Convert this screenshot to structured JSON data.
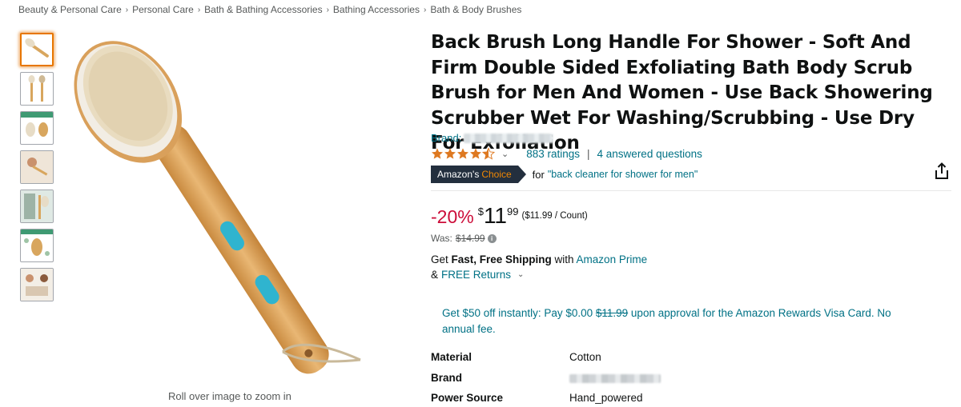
{
  "breadcrumb": {
    "items": [
      "Beauty & Personal Care",
      "Personal Care",
      "Bath & Bathing Accessories",
      "Bathing Accessories",
      "Bath & Body Brushes"
    ],
    "separator": "›"
  },
  "gallery": {
    "thumbnail_count": 7,
    "selected_index": 0,
    "zoom_hint": "Roll over image to zoom in"
  },
  "product": {
    "title": "Back Brush Long Handle For Shower - Soft And Firm Double Sided Exfoliating Bath Body Scrub Brush for Men And Women - Use Back Showering Scrubber Wet For Washing/Scrubbing - Use Dry For Exfoliation",
    "brand_label": "Brand:",
    "rating_stars": 4.5,
    "ratings_text": "883 ratings",
    "answered_text": "4 answered questions",
    "choice_badge_prefix": "Amazon's",
    "choice_badge_word": "Choice",
    "choice_for": "for",
    "choice_query": "\"back cleaner for shower for men\""
  },
  "price": {
    "discount": "-20%",
    "currency_symbol": "$",
    "whole": "11",
    "fraction": "99",
    "per_unit": "($11.99 / Count)",
    "was_label": "Was:",
    "was_price": "$14.99",
    "info_icon_text": "i"
  },
  "shipping": {
    "get": "Get ",
    "fast_free": "Fast, Free Shipping",
    "with": " with ",
    "prime_link": "Amazon Prime",
    "returns_prefix": "& ",
    "returns_link": "FREE Returns"
  },
  "promo": {
    "text_before": "Get $50 off instantly: Pay $0.00 ",
    "strike_price": "$11.99",
    "text_after": " upon approval for the Amazon Rewards Visa Card. No annual fee."
  },
  "specs": [
    {
      "key": "Material",
      "value": "Cotton"
    },
    {
      "key": "Brand",
      "value": ""
    },
    {
      "key": "Power Source",
      "value": "Hand_powered"
    }
  ],
  "colors": {
    "link": "#007185",
    "discount": "#cc0c39",
    "star": "#de7921",
    "badge_bg": "#232f3e",
    "badge_accent": "#f08804",
    "selected_thumb": "#e77600"
  },
  "icons": {
    "share": "share-icon",
    "chevron": "chevron-down-icon",
    "info": "info-icon"
  }
}
